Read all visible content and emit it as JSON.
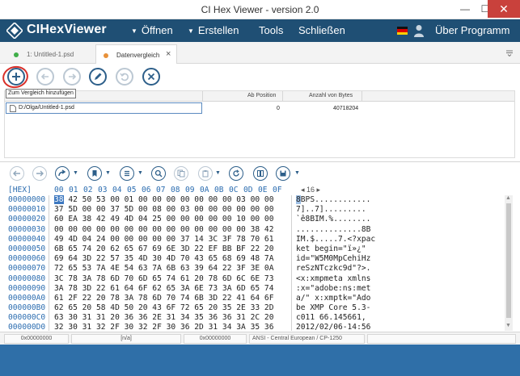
{
  "window": {
    "title": "CI Hex Viewer - version 2.0",
    "minimize": "—",
    "maximize": "☐",
    "close": "✕"
  },
  "menubar": {
    "app_name": "CIHexViewer",
    "items": [
      {
        "label": "Öffnen",
        "has_arrow": true
      },
      {
        "label": "Erstellen",
        "has_arrow": true
      },
      {
        "label": "Tools",
        "has_arrow": false
      },
      {
        "label": "Schließen",
        "has_arrow": false
      }
    ],
    "about": "Über Programm",
    "language_flag": "de-flag-icon",
    "user_icon": "user-icon"
  },
  "tabs": [
    {
      "label": "1: Untitled-1.psd",
      "dot_color": "#3fae49",
      "active": false
    },
    {
      "label": "Datenvergleich",
      "dot_color": "#e8913a",
      "active": true,
      "close": "×"
    }
  ],
  "toolbar": {
    "buttons": [
      "add-icon",
      "back-icon",
      "forward-icon",
      "edit-icon",
      "undo-icon",
      "remove-icon"
    ],
    "tooltip": "Zum Vergleich hinzufügen"
  },
  "compare_table": {
    "columns": [
      "Ab Position",
      "Anzahl von Bytes"
    ],
    "rows": [
      {
        "file": "D:/Olga/Untitled-1.psd",
        "position": "0",
        "bytes": "40718204"
      }
    ]
  },
  "hex_toolbar": {
    "page_indicator": "16"
  },
  "hex": {
    "label": "[HEX]",
    "columns": [
      "00",
      "01",
      "02",
      "03",
      "04",
      "05",
      "06",
      "07",
      "08",
      "09",
      "0A",
      "0B",
      "0C",
      "0D",
      "0E",
      "0F"
    ],
    "rows": [
      {
        "addr": "00000000",
        "hex": "38 42 50 53 00 01 00 00 00 00 00 00 00 03 00 00",
        "ascii": "8BPS............"
      },
      {
        "addr": "00000010",
        "hex": "37 5D 00 00 37 5D 00 08 00 03 00 00 00 00 00 00",
        "ascii": "7]..7]........."
      },
      {
        "addr": "00000020",
        "hex": "60 EA 38 42 49 4D 04 25 00 00 00 00 00 10 00 00",
        "ascii": "`ê8BIM.%........"
      },
      {
        "addr": "00000030",
        "hex": "00 00 00 00 00 00 00 00 00 00 00 00 00 00 38 42",
        "ascii": "..............8B"
      },
      {
        "addr": "00000040",
        "hex": "49 4D 04 24 00 00 00 00 00 37 14 3C 3F 78 70 61",
        "ascii": "IM.$.....7.<?xpac"
      },
      {
        "addr": "00000050",
        "hex": "6B 65 74 20 62 65 67 69 6E 3D 22 EF BB BF 22 20",
        "ascii": "ket begin=\"ï»¿\" "
      },
      {
        "addr": "00000060",
        "hex": "69 64 3D 22 57 35 4D 30 4D 70 43 65 68 69 48 7A",
        "ascii": "id=\"W5M0MpCehiHz"
      },
      {
        "addr": "00000070",
        "hex": "72 65 53 7A 4E 54 63 7A 6B 63 39 64 22 3F 3E 0A",
        "ascii": "reSzNTczkc9d\"?>."
      },
      {
        "addr": "00000080",
        "hex": "3C 78 3A 78 6D 70 6D 65 74 61 20 78 6D 6C 6E 73",
        "ascii": "<x:xmpmeta xmlns"
      },
      {
        "addr": "00000090",
        "hex": "3A 78 3D 22 61 64 6F 62 65 3A 6E 73 3A 6D 65 74",
        "ascii": ":x=\"adobe:ns:met"
      },
      {
        "addr": "000000A0",
        "hex": "61 2F 22 20 78 3A 78 6D 70 74 6B 3D 22 41 64 6F",
        "ascii": "a/\" x:xmptk=\"Ado"
      },
      {
        "addr": "000000B0",
        "hex": "62 65 20 58 4D 50 20 43 6F 72 65 20 35 2E 33 2D",
        "ascii": "be XMP Core 5.3-"
      },
      {
        "addr": "000000C0",
        "hex": "63 30 31 31 20 36 36 2E 31 34 35 36 36 31 2C 20",
        "ascii": "c011 66.145661, "
      },
      {
        "addr": "000000D0",
        "hex": "32 30 31 32 2F 30 32 2F 30 36 2D 31 34 3A 35 36",
        "ascii": "2012/02/06-14:56"
      }
    ]
  },
  "status": {
    "offset1": "0x00000000",
    "selection": "[n/a]",
    "offset2": "0x00000000",
    "encoding": "ANSI - Central European / CP-1250"
  }
}
